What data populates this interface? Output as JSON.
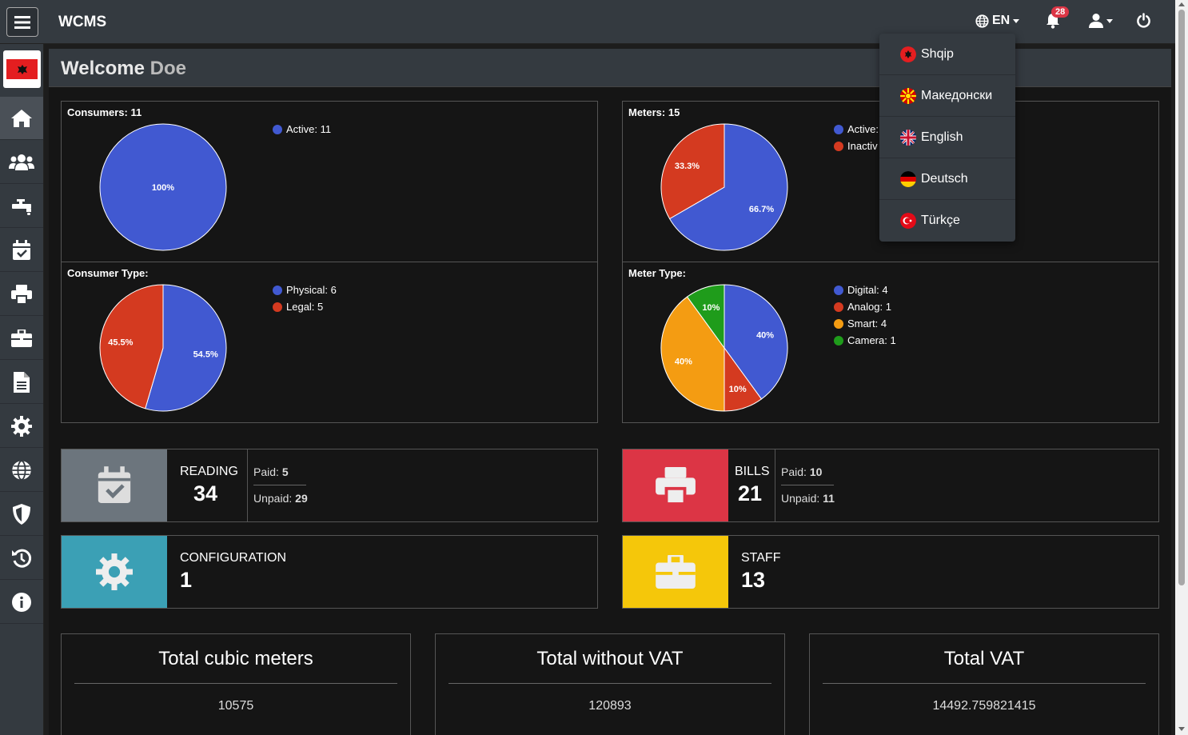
{
  "app": {
    "brand": "WCMS"
  },
  "topbar": {
    "language": "EN",
    "notification_count": "28"
  },
  "welcome": {
    "prefix": "Welcome",
    "name": "Doe"
  },
  "language_menu": [
    {
      "label": "Shqip",
      "flag": "albania-flag-icon"
    },
    {
      "label": "Македонски",
      "flag": "macedonia-flag-icon"
    },
    {
      "label": "English",
      "flag": "uk-flag-icon"
    },
    {
      "label": "Deutsch",
      "flag": "germany-flag-icon"
    },
    {
      "label": "Türkçe",
      "flag": "turkey-flag-icon"
    }
  ],
  "sidebar": {
    "items": [
      {
        "icon": "home-icon"
      },
      {
        "icon": "users-icon"
      },
      {
        "icon": "faucet-icon"
      },
      {
        "icon": "calendar-check-icon"
      },
      {
        "icon": "print-icon"
      },
      {
        "icon": "briefcase-icon"
      },
      {
        "icon": "file-icon"
      },
      {
        "icon": "gear-icon"
      },
      {
        "icon": "globe-icon"
      },
      {
        "icon": "shield-icon"
      },
      {
        "icon": "history-icon"
      },
      {
        "icon": "info-icon"
      }
    ]
  },
  "colors": {
    "blue": "#4159d1",
    "red": "#d43a20",
    "orange": "#f49c12",
    "green": "#1f9c1b"
  },
  "chart_data": [
    {
      "type": "pie",
      "title": "Consumers: 11",
      "categories": [
        "Active"
      ],
      "values": [
        11
      ],
      "labels": [
        "100%"
      ],
      "legend": [
        "Active: 11"
      ],
      "colors": [
        "#4159d1"
      ]
    },
    {
      "type": "pie",
      "title": "Meters: 15",
      "categories": [
        "Active",
        "Inactive"
      ],
      "values": [
        10,
        5
      ],
      "labels": [
        "66.7%",
        "33.3%"
      ],
      "legend": [
        "Active:",
        "Inactiv"
      ],
      "colors": [
        "#4159d1",
        "#d43a20"
      ]
    },
    {
      "type": "pie",
      "title": "Consumer Type:",
      "categories": [
        "Physical",
        "Legal"
      ],
      "values": [
        6,
        5
      ],
      "labels": [
        "54.5%",
        "45.5%"
      ],
      "legend": [
        "Physical: 6",
        "Legal: 5"
      ],
      "colors": [
        "#4159d1",
        "#d43a20"
      ]
    },
    {
      "type": "pie",
      "title": "Meter Type:",
      "categories": [
        "Digital",
        "Analog",
        "Smart",
        "Camera"
      ],
      "values": [
        4,
        1,
        4,
        1
      ],
      "labels": [
        "40%",
        "10%",
        "40%",
        "10%"
      ],
      "legend": [
        "Digital: 4",
        "Analog: 1",
        "Smart: 4",
        "Camera: 1"
      ],
      "colors": [
        "#4159d1",
        "#d43a20",
        "#f49c12",
        "#1f9c1b"
      ]
    }
  ],
  "stats": {
    "reading": {
      "label": "READING",
      "value": "34",
      "paid_label": "Paid:",
      "paid": "5",
      "unpaid_label": "Unpaid:",
      "unpaid": "29",
      "color": "#6c757d"
    },
    "bills": {
      "label": "BILLS",
      "value": "21",
      "paid_label": "Paid:",
      "paid": "10",
      "unpaid_label": "Unpaid:",
      "unpaid": "11",
      "color": "#dc3545"
    },
    "configuration": {
      "label": "CONFIGURATION",
      "value": "1",
      "color": "#3ba0b5"
    },
    "staff": {
      "label": "STAFF",
      "value": "13",
      "color": "#f5c70a"
    }
  },
  "totals": [
    {
      "title": "Total cubic meters",
      "value": "10575"
    },
    {
      "title": "Total without VAT",
      "value": "120893"
    },
    {
      "title": "Total VAT",
      "value": "14492.759821415"
    }
  ]
}
